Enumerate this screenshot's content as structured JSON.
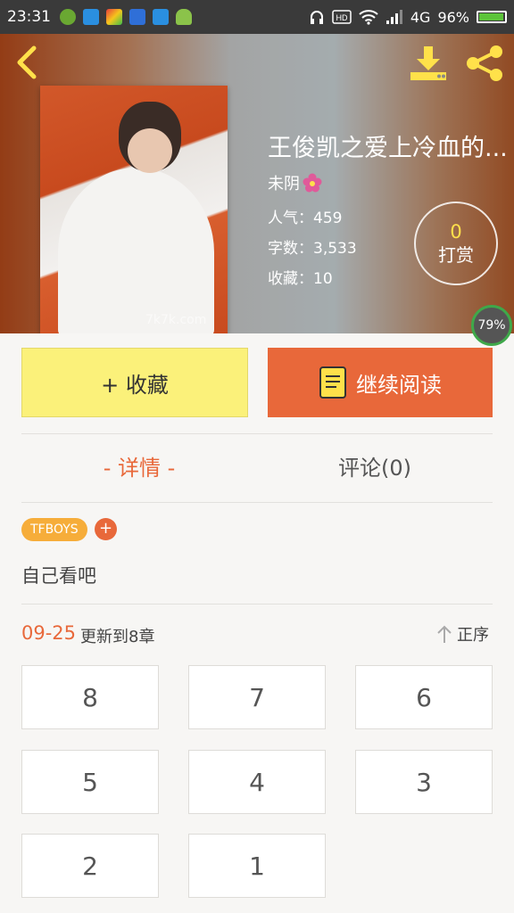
{
  "status_bar": {
    "time": "23:31",
    "network": "4G",
    "battery": "96%",
    "battery_level": 0.96,
    "app_icons": [
      "green-circle-icon",
      "blue-signal-icon",
      "colorful-app-icon",
      "paw-icon",
      "scan-icon",
      "android-icon"
    ],
    "icons": [
      "headphones-icon",
      "hd-icon",
      "wifi-icon",
      "signal-icon",
      "battery-icon"
    ]
  },
  "header": {
    "back_icon": "chevron-left-icon",
    "download_icon": "download-icon",
    "share_icon": "share-icon",
    "icon_color": "#ffe14a"
  },
  "book": {
    "title": "王俊凯之爱上冷血的...",
    "author": "未阴",
    "author_badge_icon": "flower-icon",
    "popularity": "人气：459",
    "word_count": "字数：3,533",
    "favorites": "收藏：10",
    "cover_watermark": "7k7k.com"
  },
  "tip": {
    "count": "0",
    "label": "打赏"
  },
  "progress_badge": "79%",
  "actions": {
    "favorite": "+ 收藏",
    "continue_reading": "继续阅读",
    "book_icon": "book-icon",
    "accent": "#e8683a",
    "favorite_color": "#fbf17a"
  },
  "tabs": {
    "detail": "- 详情 -",
    "comments": "评论(0)"
  },
  "tags": {
    "items": [
      "TFBOYS"
    ],
    "add": "+"
  },
  "description": "自己看吧",
  "update": {
    "date": "09-25",
    "text": "更新到8章",
    "sort_label": "正序",
    "sort_icon": "arrow-up-icon"
  },
  "chapters": [
    "8",
    "7",
    "6",
    "5",
    "4",
    "3",
    "2",
    "1"
  ]
}
